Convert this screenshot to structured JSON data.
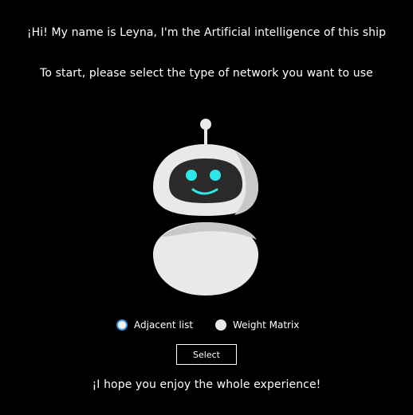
{
  "messages": {
    "greeting": "¡Hi! My name is Leyna, I'm the Artificial intelligence of this ship",
    "instruction": "To start, please select the type of network you want to use",
    "closing": "¡I hope you enjoy the whole experience!"
  },
  "robot": {
    "icon": "robot-mascot-icon",
    "colors": {
      "body": "#e9e9e9",
      "shade": "#c8c8c8",
      "visor": "#2a2a2a",
      "eyes": "#2ee6e6"
    }
  },
  "network_options": [
    {
      "label": "Adjacent list",
      "focused": true,
      "selected": false
    },
    {
      "label": "Weight Matrix",
      "focused": false,
      "selected": false
    }
  ],
  "select_button": {
    "label": "Select"
  },
  "colors": {
    "background": "#000000",
    "text": "#ffffff",
    "focus_ring": "#3d95e0"
  }
}
